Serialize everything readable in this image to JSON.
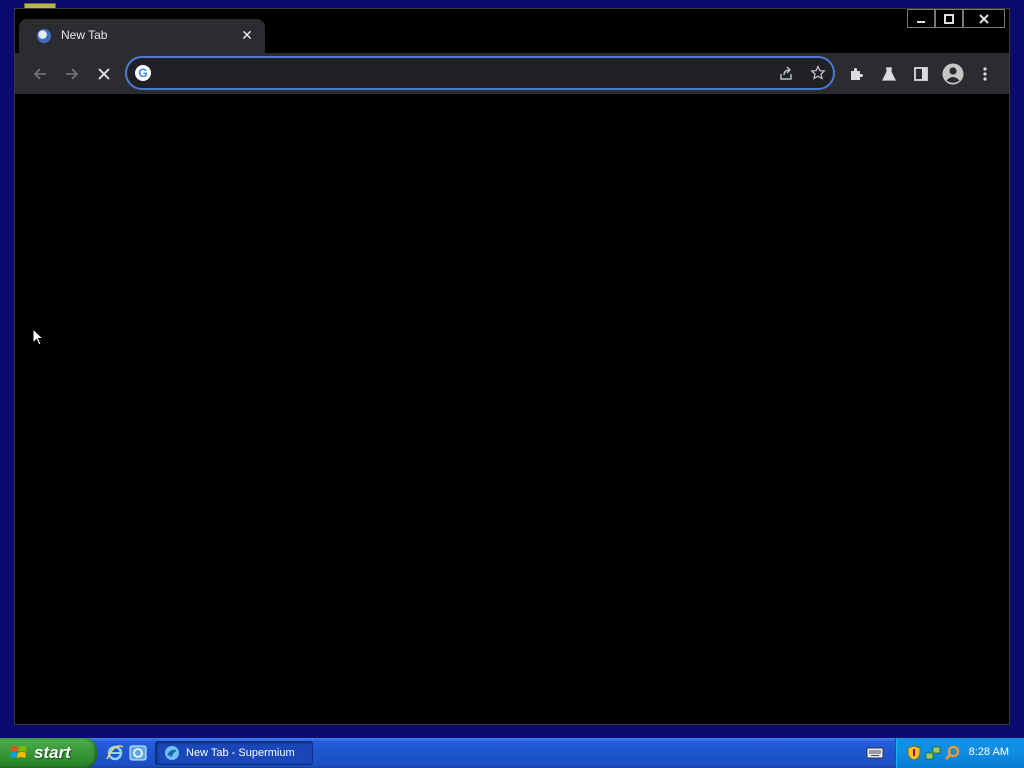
{
  "browser": {
    "tab": {
      "title": "New Tab",
      "close_glyph": "✕",
      "favicon": "supermium-favicon"
    },
    "window_controls": {
      "minimize": "▁",
      "maximize": "□",
      "close": "✕"
    },
    "omnibox": {
      "value": "",
      "placeholder": "",
      "search_engine_icon": "G"
    },
    "accent_color": "#4b7bd0"
  },
  "taskbar": {
    "start_label": "start",
    "task_button_label": "New Tab - Supermium",
    "clock": "8:28 AM"
  }
}
